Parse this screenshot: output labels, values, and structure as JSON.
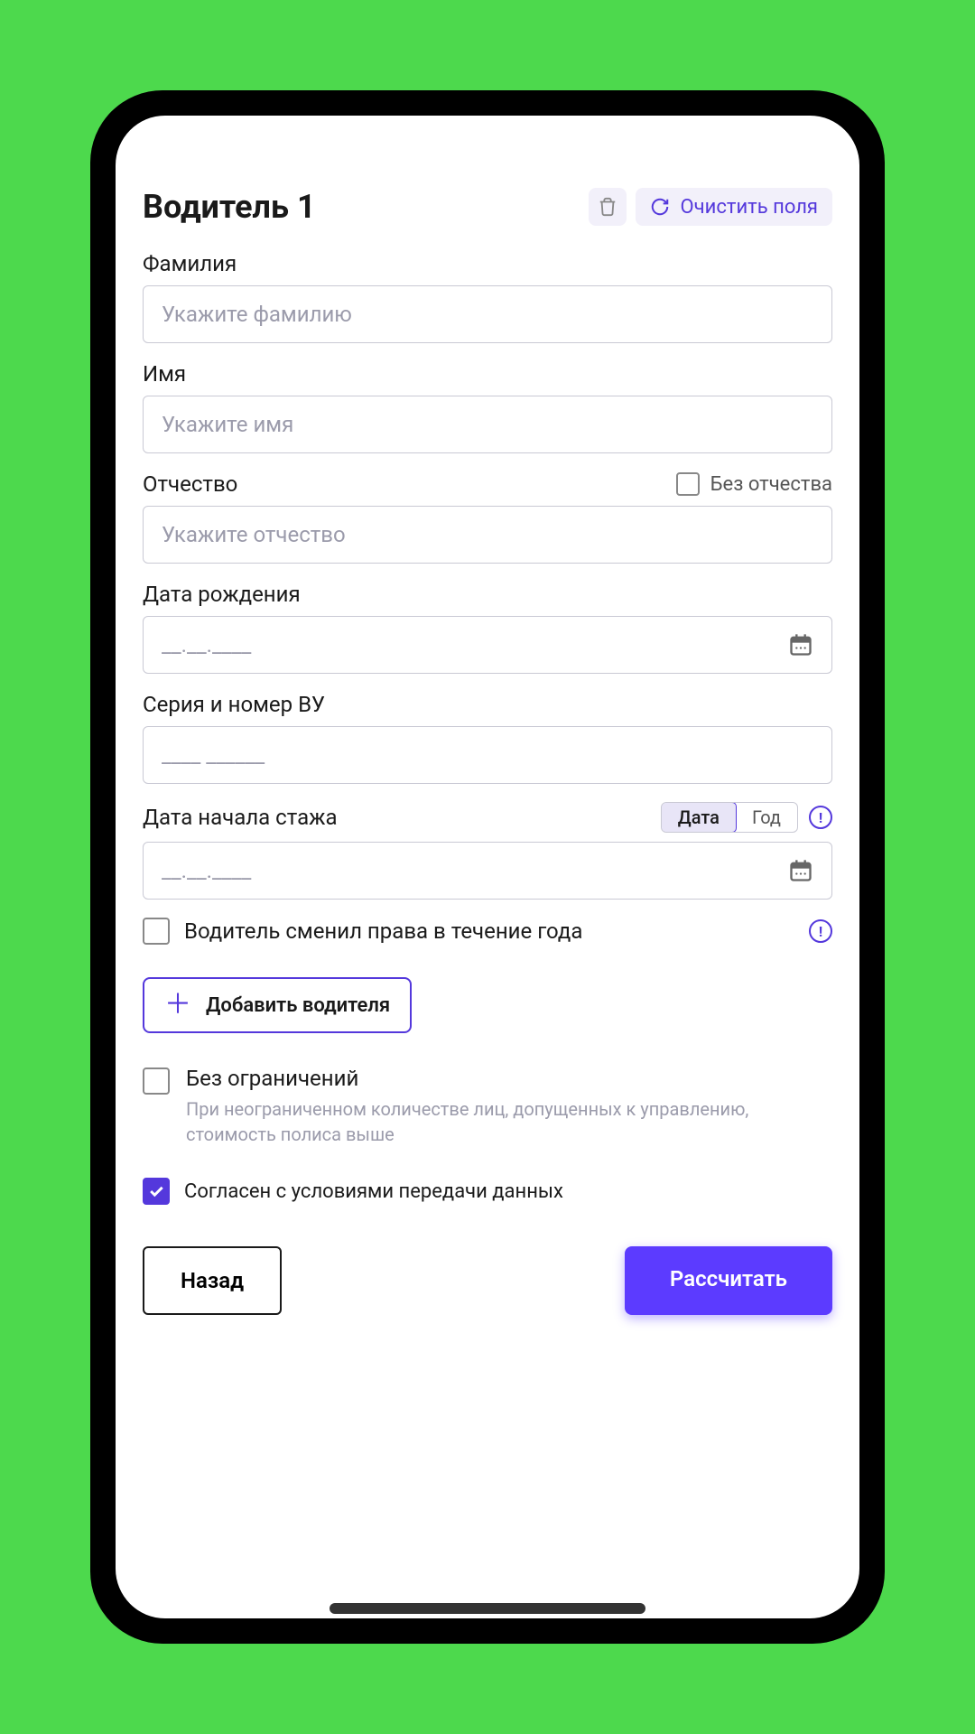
{
  "header": {
    "title": "Водитель 1",
    "clear_label": "Очистить поля"
  },
  "fields": {
    "lastname": {
      "label": "Фамилия",
      "placeholder": "Укажите фамилию"
    },
    "firstname": {
      "label": "Имя",
      "placeholder": "Укажите имя"
    },
    "patronymic": {
      "label": "Отчество",
      "placeholder": "Укажите отчество",
      "no_patronymic": "Без отчества"
    },
    "birthdate": {
      "label": "Дата рождения",
      "placeholder": "__.__.____"
    },
    "license": {
      "label": "Серия и номер ВУ",
      "placeholder": "____  ______"
    },
    "experience": {
      "label": "Дата начала стажа",
      "placeholder": "__.__.____",
      "opt_date": "Дата",
      "opt_year": "Год"
    }
  },
  "license_changed": "Водитель сменил права в течение года",
  "add_driver": "Добавить водителя",
  "no_limit": {
    "title": "Без ограничений",
    "sub": "При неограниченном количестве лиц, допущенных к управлению, стоимость полиса выше"
  },
  "consent": "Согласен с условиями передачи данных",
  "buttons": {
    "back": "Назад",
    "calc": "Рассчитать"
  }
}
